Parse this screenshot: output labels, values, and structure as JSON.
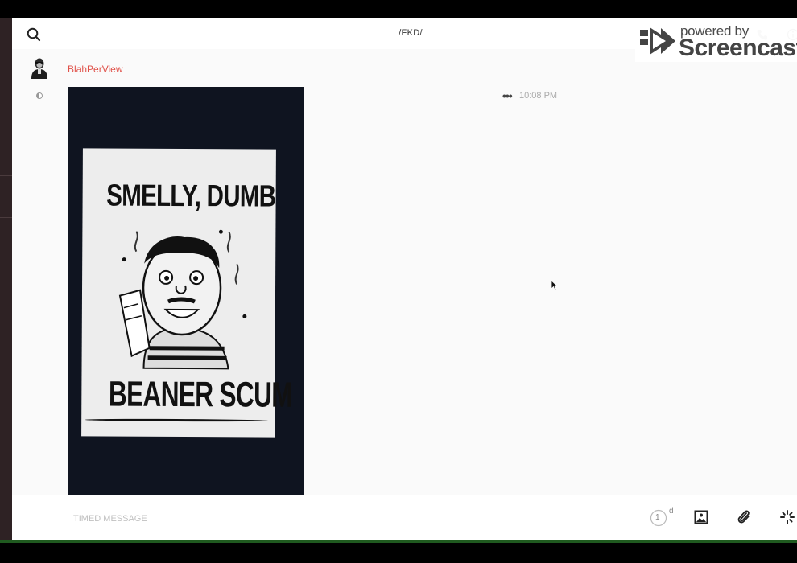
{
  "header": {
    "channel_title": "/FKD/",
    "search_icon": "search-icon",
    "call_icon": "phone-icon",
    "info_icon": "info-icon"
  },
  "watermark": {
    "powered": "powered by",
    "name": "Screencastify"
  },
  "message": {
    "username": "BlahPerView",
    "menu": "•••",
    "time": "10:08 PM",
    "attachment": {
      "type": "image",
      "poster_line1": "SMELLY, DUMB",
      "poster_line2": "BEANER SCUM"
    }
  },
  "composer": {
    "placeholder": "TIMED MESSAGE",
    "timer_value": "1",
    "timer_unit": "d",
    "image_icon": "image-icon",
    "attach_icon": "paperclip-icon",
    "effects_icon": "sparkle-icon"
  },
  "colors": {
    "username": "#e0524a",
    "background": "#fafafa",
    "accent_bottom": "#1f5a1f"
  }
}
